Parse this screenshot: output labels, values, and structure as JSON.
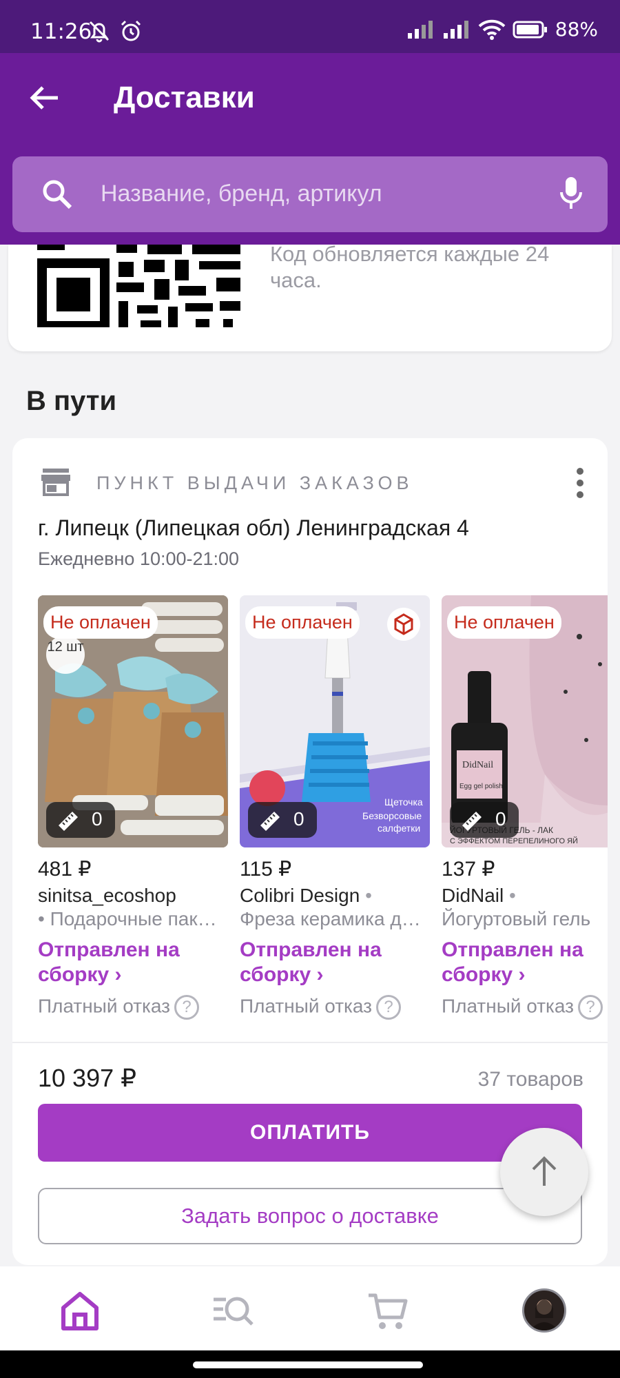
{
  "status_bar": {
    "time": "11:26",
    "battery": "88%"
  },
  "app_bar": {
    "title": "Доставки"
  },
  "search": {
    "placeholder": "Название, бренд, артикул"
  },
  "qr_card": {
    "note": "Код обновляется каждые 24 часа."
  },
  "section": {
    "title": "В пути"
  },
  "order": {
    "pickup_label": "ПУНКТ ВЫДАЧИ ЗАКАЗОВ",
    "address": "г. Липецк (Липецкая обл) Ленинградская 4",
    "hours": "Ежедневно 10:00-21:00",
    "products": [
      {
        "badge": "Не оплачен",
        "qty": "12 шт",
        "ruler_count": "0",
        "price": "481 ₽",
        "seller": "sinitsa_ecoshop",
        "desc": "• Подарочные пак…",
        "status": "Отправлен на сборку ›",
        "refuse": "Платный отказ"
      },
      {
        "badge": "Не оплачен",
        "ruler_count": "0",
        "price": "115 ₽",
        "seller": "Colibri Design",
        "desc": "Фреза керамика д…",
        "status": "Отправлен на сборку ›",
        "refuse": "Платный отказ"
      },
      {
        "badge": "Не оплачен",
        "ruler_count": "0",
        "price": "137 ₽",
        "seller": "DidNail",
        "desc": "Йогуртовый гель",
        "status": "Отправлен на сборку ›",
        "refuse": "Платный отказ"
      }
    ],
    "total": "10 397 ₽",
    "count": "37 товаров",
    "pay_label": "ОПЛАТИТЬ",
    "ask_label": "Задать вопрос о доставке"
  },
  "colors": {
    "accent": "#a43cc4",
    "appbar": "#6b1c99",
    "statusbar": "#4d1a7a",
    "badge_red": "#c52b1c"
  },
  "bottom_nav": [
    "home-icon",
    "catalog-search-icon",
    "cart-icon",
    "profile-avatar"
  ]
}
